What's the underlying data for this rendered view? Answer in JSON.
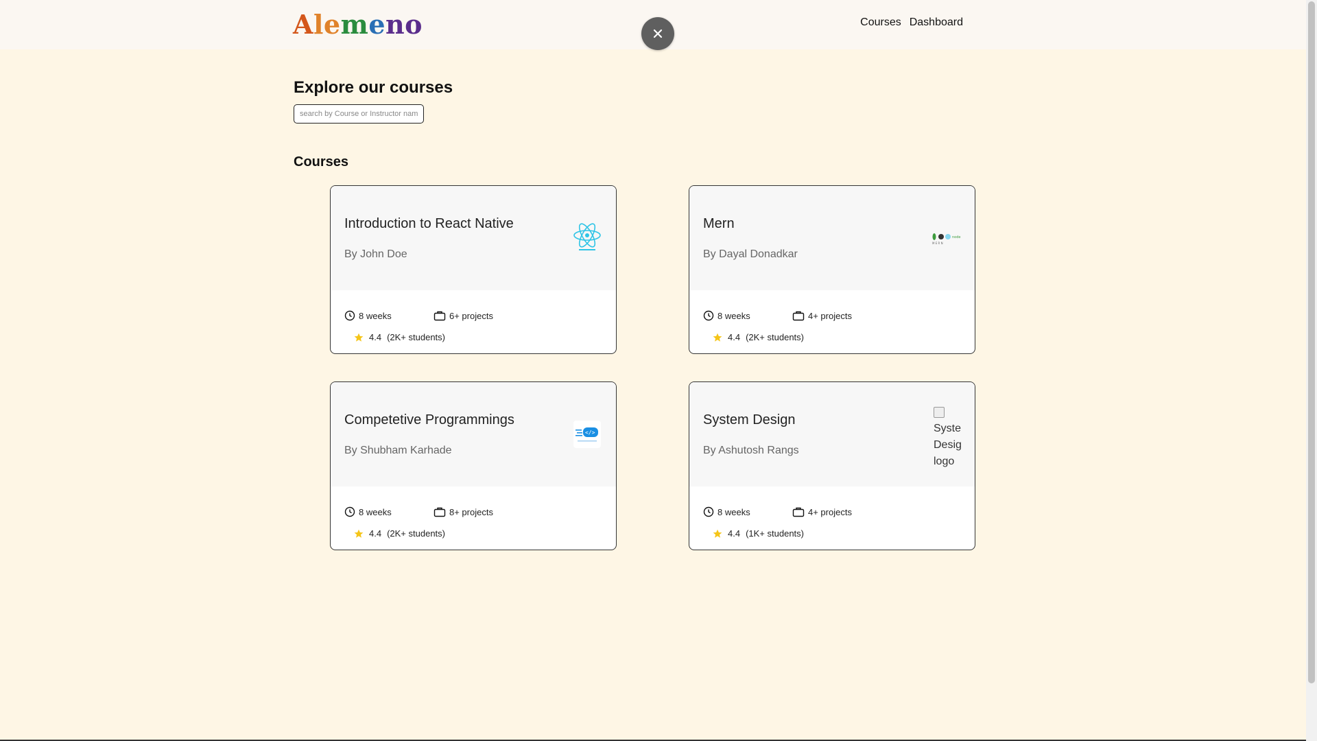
{
  "header": {
    "logo_letters": [
      "A",
      "le",
      "m",
      "e",
      "n",
      "o"
    ],
    "nav": [
      {
        "label": "Courses"
      },
      {
        "label": "Dashboard"
      }
    ],
    "close_icon": "close-icon"
  },
  "main": {
    "title": "Explore our courses",
    "search_placeholder": "search by Course or Instructor name",
    "section_title": "Courses"
  },
  "courses": [
    {
      "title": "Introduction to React Native",
      "author": "By John Doe",
      "duration": "8 weeks",
      "projects": "6+ projects",
      "rating": "4.4",
      "students": "(2K+ students)",
      "logo": "react-native-logo"
    },
    {
      "title": "Mern",
      "author": "By Dayal Donadkar",
      "duration": "8 weeks",
      "projects": "4+ projects",
      "rating": "4.4",
      "students": "(2K+ students)",
      "logo": "mern-logo"
    },
    {
      "title": "Competetive Programmings",
      "author": "By Shubham Karhade",
      "duration": "8 weeks",
      "projects": "8+ projects",
      "rating": "4.4",
      "students": "(2K+ students)",
      "logo": "code-logo"
    },
    {
      "title": "System Design",
      "author": "By Ashutosh Rangs",
      "duration": "8 weeks",
      "projects": "4+ projects",
      "rating": "4.4",
      "students": "(1K+ students)",
      "logo": "broken-image",
      "logo_alt_lines": [
        "System",
        "Design",
        "logo"
      ]
    }
  ],
  "colors": {
    "background": "#FEF6E5",
    "header": "#FBF7F2",
    "star": "#F5C518",
    "react": "#2EC4E6"
  }
}
